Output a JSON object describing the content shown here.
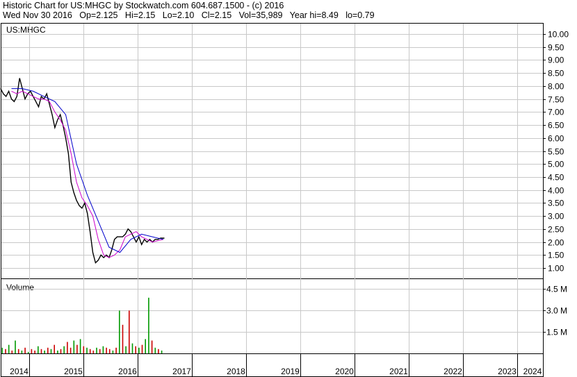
{
  "header": {
    "line1": "Historic Chart for US:MHGC by Stockwatch.com 604.687.1500 - (c) 2016",
    "line2": "Wed Nov 30 2016   Op=2.125   Hi=2.15   Lo=2.10   Cl=2.15   Vol=35,989   Year hi=8.49   lo=0.79"
  },
  "chart_data": [
    {
      "type": "line",
      "title": "US:MHGC",
      "ylim": [
        0.6,
        10.4
      ],
      "yticks": [
        "10.00",
        "9.50",
        "9.00",
        "8.50",
        "8.00",
        "7.50",
        "7.00",
        "6.50",
        "6.00",
        "5.50",
        "5.00",
        "4.50",
        "4.00",
        "3.50",
        "3.00",
        "2.50",
        "2.00",
        "1.50",
        "1.00"
      ],
      "grid": true,
      "x_categories": [
        "2014",
        "2015",
        "2016",
        "2017",
        "2018",
        "2019",
        "2020",
        "2021",
        "2022",
        "2023",
        "2024"
      ],
      "series": [
        {
          "kind": "price",
          "color": "#000000",
          "x": [
            2013.9,
            2013.95,
            2014.0,
            2014.05,
            2014.1,
            2014.15,
            2014.2,
            2014.25,
            2014.3,
            2014.35,
            2014.4,
            2014.45,
            2014.5,
            2014.55,
            2014.6,
            2014.65,
            2014.7,
            2014.75,
            2014.8,
            2014.85,
            2014.9,
            2014.95,
            2015.0,
            2015.05,
            2015.1,
            2015.15,
            2015.2,
            2015.25,
            2015.3,
            2015.35,
            2015.4,
            2015.45,
            2015.5,
            2015.55,
            2015.6,
            2015.65,
            2015.7,
            2015.75,
            2015.8,
            2015.85,
            2015.9,
            2015.95,
            2016.0,
            2016.05,
            2016.1,
            2016.15,
            2016.2,
            2016.25,
            2016.3,
            2016.35,
            2016.4,
            2016.45,
            2016.5,
            2016.55,
            2016.6,
            2016.65,
            2016.7,
            2016.75,
            2016.8,
            2016.85,
            2016.92
          ],
          "values": [
            7.9,
            7.7,
            7.6,
            7.8,
            7.5,
            7.4,
            7.6,
            8.3,
            7.9,
            7.5,
            7.7,
            7.8,
            7.6,
            7.4,
            7.2,
            7.6,
            7.5,
            7.7,
            7.3,
            6.9,
            6.4,
            6.7,
            6.9,
            6.5,
            6.0,
            5.4,
            4.3,
            3.9,
            3.6,
            3.4,
            3.3,
            3.5,
            3.1,
            2.4,
            1.6,
            1.2,
            1.3,
            1.5,
            1.4,
            1.5,
            1.4,
            1.7,
            2.1,
            2.2,
            2.2,
            2.2,
            2.3,
            2.5,
            2.4,
            2.2,
            2.0,
            2.2,
            1.9,
            2.1,
            2.0,
            2.1,
            2.0,
            2.1,
            2.1,
            2.15,
            2.15
          ]
        },
        {
          "kind": "moving-average-short",
          "color": "#cc00cc",
          "x": [
            2014.1,
            2014.2,
            2014.3,
            2014.4,
            2014.5,
            2014.6,
            2014.7,
            2014.8,
            2014.9,
            2015.0,
            2015.1,
            2015.2,
            2015.3,
            2015.4,
            2015.5,
            2015.6,
            2015.7,
            2015.8,
            2015.9,
            2016.0,
            2016.1,
            2016.2,
            2016.3,
            2016.4,
            2016.5,
            2016.6,
            2016.7,
            2016.8,
            2016.9
          ],
          "values": [
            7.8,
            7.7,
            7.8,
            7.7,
            7.6,
            7.5,
            7.5,
            7.4,
            7.0,
            6.7,
            6.3,
            5.4,
            4.3,
            3.7,
            3.4,
            3.0,
            2.1,
            1.5,
            1.4,
            1.5,
            1.7,
            2.2,
            2.3,
            2.4,
            2.2,
            2.1,
            2.0,
            2.05,
            2.1
          ]
        },
        {
          "kind": "moving-average-long",
          "color": "#0000cc",
          "x": [
            2014.1,
            2014.3,
            2014.5,
            2014.7,
            2014.9,
            2015.1,
            2015.3,
            2015.5,
            2015.7,
            2015.9,
            2016.1,
            2016.3,
            2016.5,
            2016.7,
            2016.9
          ],
          "values": [
            7.9,
            7.9,
            7.8,
            7.6,
            7.4,
            6.9,
            5.0,
            3.8,
            2.8,
            1.8,
            1.6,
            2.1,
            2.3,
            2.2,
            2.1
          ]
        }
      ]
    },
    {
      "type": "bar",
      "title": "Volume",
      "ylim": [
        0,
        5.2
      ],
      "yticks": [
        "4.5 M",
        "3.0 M",
        "1.5 M"
      ],
      "grid": true,
      "series": [
        {
          "name": "",
          "color_up": "#009900",
          "color_down": "#cc0000",
          "x": [
            2013.92,
            2013.98,
            2014.04,
            2014.1,
            2014.16,
            2014.22,
            2014.28,
            2014.34,
            2014.4,
            2014.46,
            2014.52,
            2014.58,
            2014.64,
            2014.7,
            2014.76,
            2014.82,
            2014.88,
            2014.94,
            2015.0,
            2015.06,
            2015.12,
            2015.18,
            2015.24,
            2015.3,
            2015.36,
            2015.42,
            2015.48,
            2015.54,
            2015.6,
            2015.66,
            2015.72,
            2015.78,
            2015.84,
            2015.9,
            2015.96,
            2016.02,
            2016.08,
            2016.14,
            2016.2,
            2016.26,
            2016.32,
            2016.38,
            2016.44,
            2016.5,
            2016.56,
            2016.62,
            2016.68,
            2016.74,
            2016.8,
            2016.86
          ],
          "values": [
            0.4,
            0.3,
            0.6,
            0.2,
            0.9,
            0.3,
            0.2,
            0.4,
            0.1,
            0.3,
            0.2,
            0.5,
            0.3,
            0.2,
            0.4,
            0.3,
            0.6,
            0.2,
            0.3,
            0.5,
            0.8,
            0.4,
            0.9,
            0.6,
            1.0,
            0.5,
            0.4,
            0.3,
            0.2,
            0.4,
            0.3,
            0.5,
            0.4,
            0.3,
            0.2,
            0.4,
            3.0,
            2.0,
            0.5,
            3.0,
            0.7,
            0.5,
            0.4,
            0.6,
            1.0,
            3.9,
            0.9,
            0.4,
            0.3,
            0.2
          ],
          "up": [
            true,
            false,
            true,
            false,
            true,
            false,
            true,
            false,
            true,
            false,
            false,
            true,
            false,
            true,
            false,
            true,
            false,
            true,
            false,
            true,
            false,
            false,
            true,
            false,
            true,
            false,
            true,
            false,
            false,
            true,
            false,
            true,
            false,
            false,
            true,
            false,
            true,
            false,
            true,
            false,
            true,
            false,
            true,
            false,
            true,
            true,
            false,
            true,
            false,
            true
          ]
        }
      ]
    }
  ]
}
